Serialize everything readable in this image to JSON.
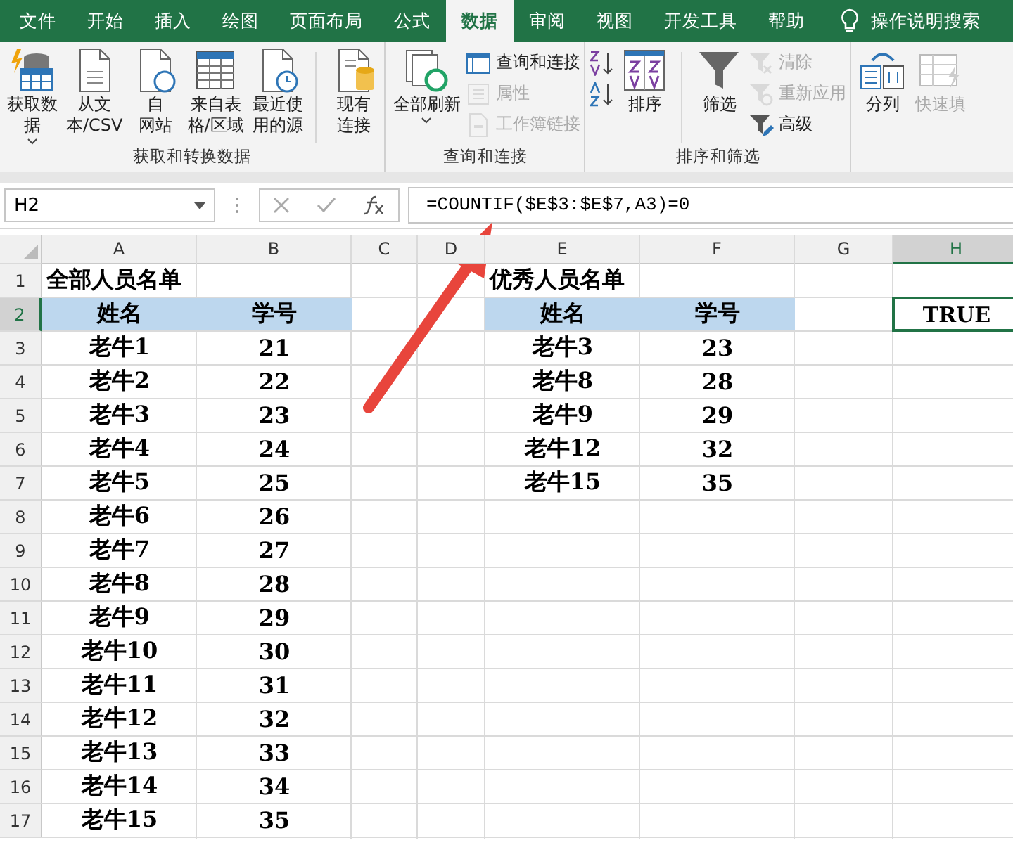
{
  "tabs": [
    {
      "label": "文件",
      "selected": false
    },
    {
      "label": "开始",
      "selected": false
    },
    {
      "label": "插入",
      "selected": false
    },
    {
      "label": "绘图",
      "selected": false
    },
    {
      "label": "页面布局",
      "selected": false
    },
    {
      "label": "公式",
      "selected": false
    },
    {
      "label": "数据",
      "selected": true
    },
    {
      "label": "审阅",
      "selected": false
    },
    {
      "label": "视图",
      "selected": false
    },
    {
      "label": "开发工具",
      "selected": false
    },
    {
      "label": "帮助",
      "selected": false
    }
  ],
  "search": {
    "label": "操作说明搜索"
  },
  "ribbon": {
    "groups": [
      {
        "title": "获取和转换数据",
        "items": [
          {
            "kind": "large",
            "lines": [
              "获取数",
              "据"
            ],
            "dropdown": true,
            "disabled": false
          },
          {
            "kind": "large",
            "lines": [
              "从文",
              "本/CSV"
            ],
            "dropdown": false,
            "disabled": false
          },
          {
            "kind": "large",
            "lines": [
              "自",
              "网站"
            ],
            "dropdown": false,
            "disabled": false
          },
          {
            "kind": "large",
            "lines": [
              "来自表",
              "格/区域"
            ],
            "dropdown": false,
            "disabled": false
          },
          {
            "kind": "large",
            "lines": [
              "最近使",
              "用的源"
            ],
            "dropdown": false,
            "disabled": false
          },
          {
            "kind": "separator"
          },
          {
            "kind": "large",
            "lines": [
              "现有",
              "连接"
            ],
            "dropdown": false,
            "disabled": false
          }
        ]
      },
      {
        "title": "查询和连接",
        "items": [
          {
            "kind": "large",
            "lines": [
              "全部刷新"
            ],
            "dropdown": true,
            "disabled": false
          },
          {
            "kind": "stack",
            "entries": [
              {
                "label": "查询和连接",
                "disabled": false
              },
              {
                "label": "属性",
                "disabled": true
              },
              {
                "label": "工作簿链接",
                "disabled": true
              }
            ]
          }
        ]
      },
      {
        "title": "排序和筛选",
        "items": [
          {
            "kind": "stack",
            "entries": [
              {
                "disabled": false
              },
              {
                "disabled": false
              }
            ]
          },
          {
            "kind": "large",
            "lines": [
              "排序"
            ],
            "dropdown": false,
            "disabled": false
          },
          {
            "kind": "separator"
          },
          {
            "kind": "large",
            "lines": [
              "筛选"
            ],
            "dropdown": false,
            "disabled": false
          },
          {
            "kind": "stack",
            "entries": [
              {
                "label": "清除",
                "disabled": true
              },
              {
                "label": "重新应用",
                "disabled": true
              },
              {
                "label": "高级",
                "disabled": false
              }
            ]
          }
        ]
      },
      {
        "items": [
          {
            "kind": "large",
            "lines": [
              "分列"
            ],
            "dropdown": false,
            "disabled": false
          },
          {
            "kind": "large",
            "lines": [
              "快速填"
            ],
            "dropdown": false,
            "disabled": true
          }
        ]
      }
    ]
  },
  "formula_bar": {
    "name_box": "H2",
    "formula": "=COUNTIF($E$3:$E$7,A3)=0"
  },
  "sheet": {
    "columns": [
      {
        "label": "A",
        "selected": false
      },
      {
        "label": "B",
        "selected": false
      },
      {
        "label": "C",
        "selected": false
      },
      {
        "label": "D",
        "selected": false
      },
      {
        "label": "E",
        "selected": false
      },
      {
        "label": "F",
        "selected": false
      },
      {
        "label": "G",
        "selected": false
      },
      {
        "label": "H",
        "selected": true
      }
    ],
    "rows": [
      {
        "number": "1",
        "kind": "title",
        "selected": false,
        "cells": {
          "a": "全部人员名单",
          "e": "优秀人员名单"
        }
      },
      {
        "number": "2",
        "kind": "header",
        "selected": true,
        "cells": {
          "a": "姓名",
          "b": "学号",
          "e": "姓名",
          "f": "学号",
          "h": "TRUE"
        }
      },
      {
        "number": "3",
        "kind": "data",
        "selected": false,
        "cells": {
          "a": "老牛1",
          "b": "21",
          "e": "老牛3",
          "f": "23"
        }
      },
      {
        "number": "4",
        "kind": "data",
        "selected": false,
        "cells": {
          "a": "老牛2",
          "b": "22",
          "e": "老牛8",
          "f": "28"
        }
      },
      {
        "number": "5",
        "kind": "data",
        "selected": false,
        "cells": {
          "a": "老牛3",
          "b": "23",
          "e": "老牛9",
          "f": "29"
        }
      },
      {
        "number": "6",
        "kind": "data",
        "selected": false,
        "cells": {
          "a": "老牛4",
          "b": "24",
          "e": "老牛12",
          "f": "32"
        }
      },
      {
        "number": "7",
        "kind": "data",
        "selected": false,
        "cells": {
          "a": "老牛5",
          "b": "25",
          "e": "老牛15",
          "f": "35"
        }
      },
      {
        "number": "8",
        "kind": "data",
        "selected": false,
        "cells": {
          "a": "老牛6",
          "b": "26"
        }
      },
      {
        "number": "9",
        "kind": "data",
        "selected": false,
        "cells": {
          "a": "老牛7",
          "b": "27"
        }
      },
      {
        "number": "10",
        "kind": "data",
        "selected": false,
        "cells": {
          "a": "老牛8",
          "b": "28"
        }
      },
      {
        "number": "11",
        "kind": "data",
        "selected": false,
        "cells": {
          "a": "老牛9",
          "b": "29"
        }
      },
      {
        "number": "12",
        "kind": "data",
        "selected": false,
        "cells": {
          "a": "老牛10",
          "b": "30"
        }
      },
      {
        "number": "13",
        "kind": "data",
        "selected": false,
        "cells": {
          "a": "老牛11",
          "b": "31"
        }
      },
      {
        "number": "14",
        "kind": "data",
        "selected": false,
        "cells": {
          "a": "老牛12",
          "b": "32"
        }
      },
      {
        "number": "15",
        "kind": "data",
        "selected": false,
        "cells": {
          "a": "老牛13",
          "b": "33"
        }
      },
      {
        "number": "16",
        "kind": "data",
        "selected": false,
        "cells": {
          "a": "老牛14",
          "b": "34"
        }
      },
      {
        "number": "17",
        "kind": "data",
        "selected": false,
        "cells": {
          "a": "老牛15",
          "b": "35"
        }
      }
    ]
  }
}
